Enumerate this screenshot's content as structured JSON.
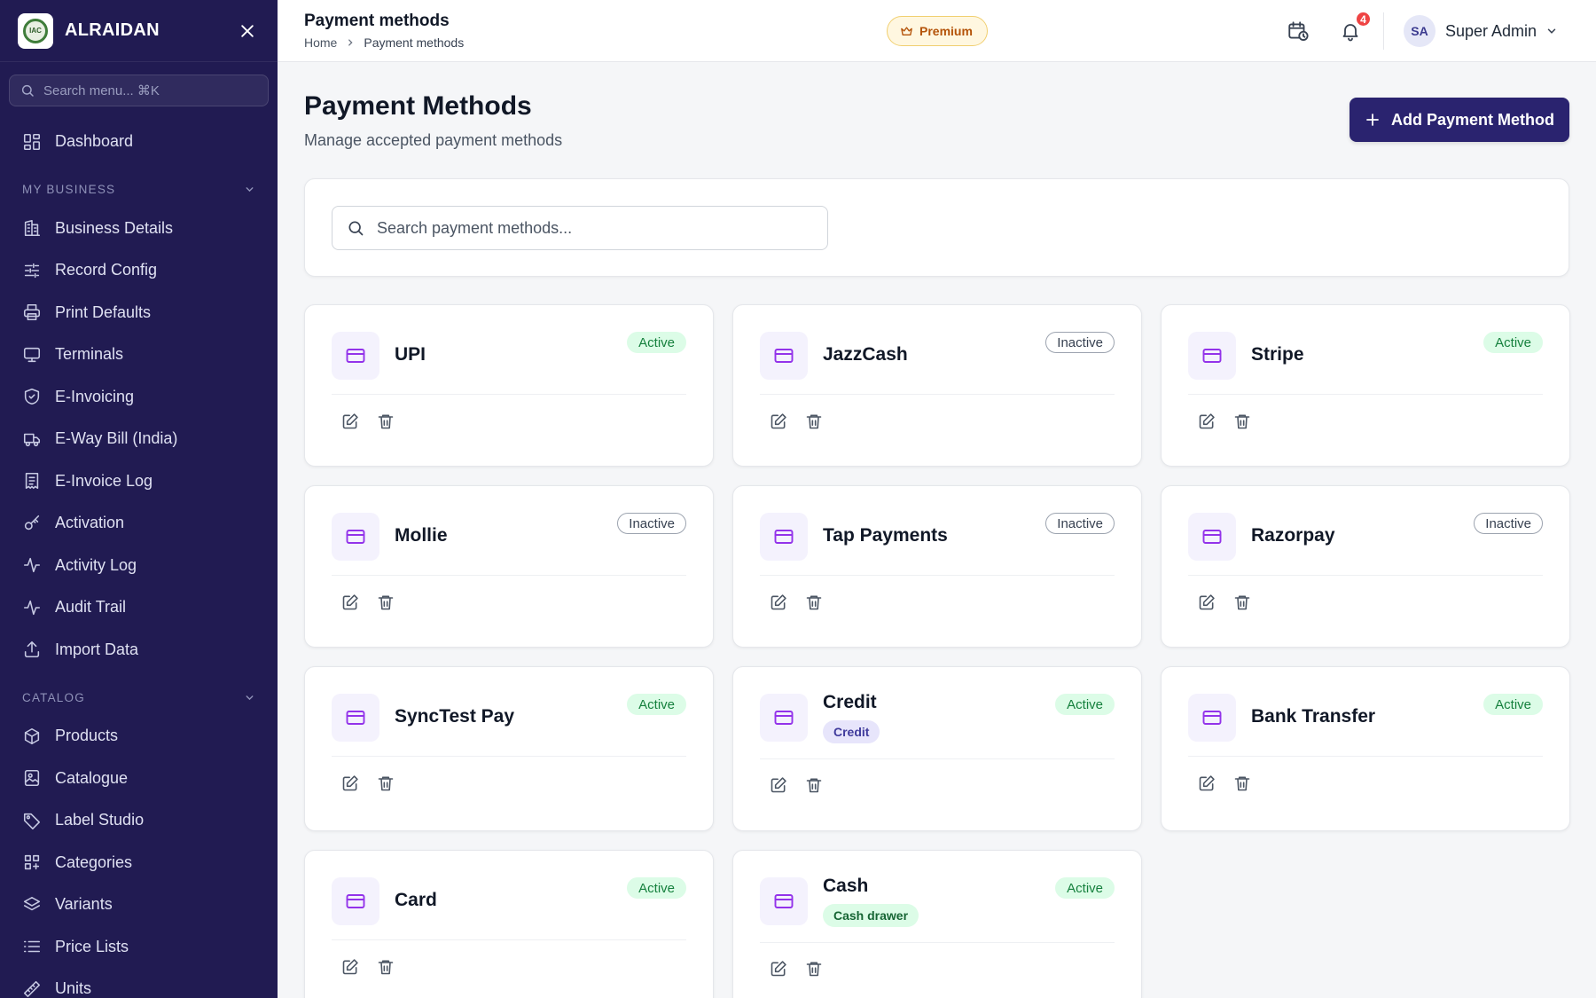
{
  "sidebar": {
    "brand": "ALRAIDAN",
    "logo_text": "IAC",
    "search_placeholder": "Search menu... ⌘K",
    "top_items": [
      {
        "label": "Dashboard",
        "icon": "dashboard-icon"
      }
    ],
    "sections": [
      {
        "title": "MY BUSINESS",
        "items": [
          {
            "label": "Business Details",
            "icon": "building-icon"
          },
          {
            "label": "Record Config",
            "icon": "sliders-icon"
          },
          {
            "label": "Print Defaults",
            "icon": "printer-icon"
          },
          {
            "label": "Terminals",
            "icon": "monitor-icon"
          },
          {
            "label": "E-Invoicing",
            "icon": "shield-icon"
          },
          {
            "label": "E-Way Bill (India)",
            "icon": "truck-icon"
          },
          {
            "label": "E-Invoice Log",
            "icon": "receipt-icon"
          },
          {
            "label": "Activation",
            "icon": "key-icon"
          },
          {
            "label": "Activity Log",
            "icon": "activity-icon"
          },
          {
            "label": "Audit Trail",
            "icon": "activity-icon"
          },
          {
            "label": "Import Data",
            "icon": "upload-icon"
          }
        ]
      },
      {
        "title": "CATALOG",
        "items": [
          {
            "label": "Products",
            "icon": "box-icon"
          },
          {
            "label": "Catalogue",
            "icon": "image-book-icon"
          },
          {
            "label": "Label Studio",
            "icon": "tag-icon"
          },
          {
            "label": "Categories",
            "icon": "categories-icon"
          },
          {
            "label": "Variants",
            "icon": "layers-icon"
          },
          {
            "label": "Price Lists",
            "icon": "list-icon"
          },
          {
            "label": "Units",
            "icon": "ruler-icon"
          }
        ]
      }
    ]
  },
  "header": {
    "title": "Payment methods",
    "breadcrumb": [
      "Home",
      "Payment methods"
    ],
    "premium_label": "Premium",
    "notification_count": "4",
    "user_initials": "SA",
    "user_name": "Super Admin"
  },
  "main": {
    "title": "Payment Methods",
    "subtitle": "Manage accepted payment methods",
    "add_button_label": "Add Payment Method",
    "search_placeholder": "Search payment methods...",
    "methods": [
      {
        "name": "UPI",
        "status": "Active",
        "tag": ""
      },
      {
        "name": "JazzCash",
        "status": "Inactive",
        "tag": ""
      },
      {
        "name": "Stripe",
        "status": "Active",
        "tag": ""
      },
      {
        "name": "Mollie",
        "status": "Inactive",
        "tag": ""
      },
      {
        "name": "Tap Payments",
        "status": "Inactive",
        "tag": ""
      },
      {
        "name": "Razorpay",
        "status": "Inactive",
        "tag": ""
      },
      {
        "name": "SyncTest Pay",
        "status": "Active",
        "tag": ""
      },
      {
        "name": "Credit",
        "status": "Active",
        "tag": "Credit"
      },
      {
        "name": "Bank Transfer",
        "status": "Active",
        "tag": ""
      },
      {
        "name": "Card",
        "status": "Active",
        "tag": ""
      },
      {
        "name": "Cash",
        "status": "Active",
        "tag": "Cash drawer"
      }
    ]
  },
  "colors": {
    "sidebar_bg": "#211b52",
    "accent": "#2a236f",
    "active_bg": "#dcfce7",
    "active_text": "#15803d",
    "icon_purple": "#9333ea",
    "badge_red": "#ef4444"
  }
}
